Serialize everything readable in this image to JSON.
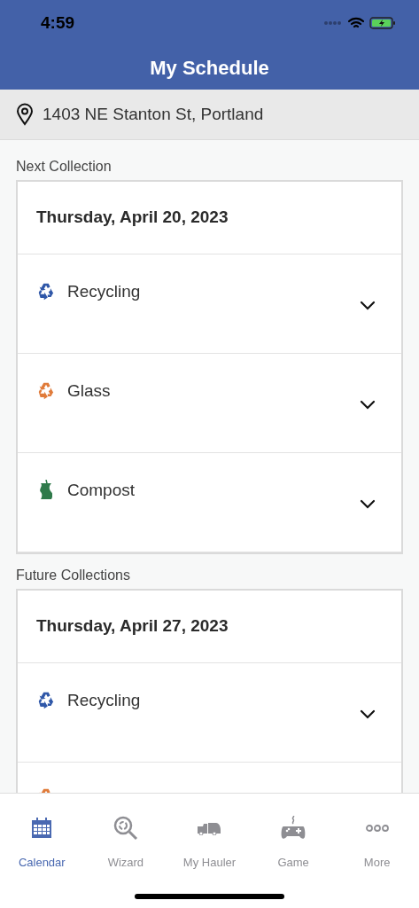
{
  "status_bar": {
    "time": "4:59"
  },
  "header": {
    "title": "My Schedule"
  },
  "address": "1403 NE Stanton St, Portland",
  "sections": [
    {
      "heading": "Next Collection",
      "date": "Thursday, April 20, 2023",
      "items": [
        {
          "kind": "recycling",
          "label": "Recycling",
          "color": "#2f57a8",
          "expanded": false
        },
        {
          "kind": "glass",
          "label": "Glass",
          "color": "#e07b3a",
          "expanded": false
        },
        {
          "kind": "compost",
          "label": "Compost",
          "color": "#2f7a4a",
          "expanded": false
        }
      ]
    },
    {
      "heading": "Future Collections",
      "date": "Thursday, April 27, 2023",
      "items": [
        {
          "kind": "recycling",
          "label": "Recycling",
          "color": "#2f57a8",
          "expanded": false
        },
        {
          "kind": "glass",
          "color": "#e07b3a"
        }
      ]
    }
  ],
  "tab_bar": [
    {
      "kind": "calendar",
      "label": "Calendar",
      "selected": true
    },
    {
      "kind": "wizard",
      "label": "Wizard",
      "selected": false
    },
    {
      "kind": "hauler",
      "label": "My Hauler",
      "selected": false
    },
    {
      "kind": "game",
      "label": "Game",
      "selected": false
    },
    {
      "kind": "more",
      "label": "More",
      "selected": false
    }
  ]
}
